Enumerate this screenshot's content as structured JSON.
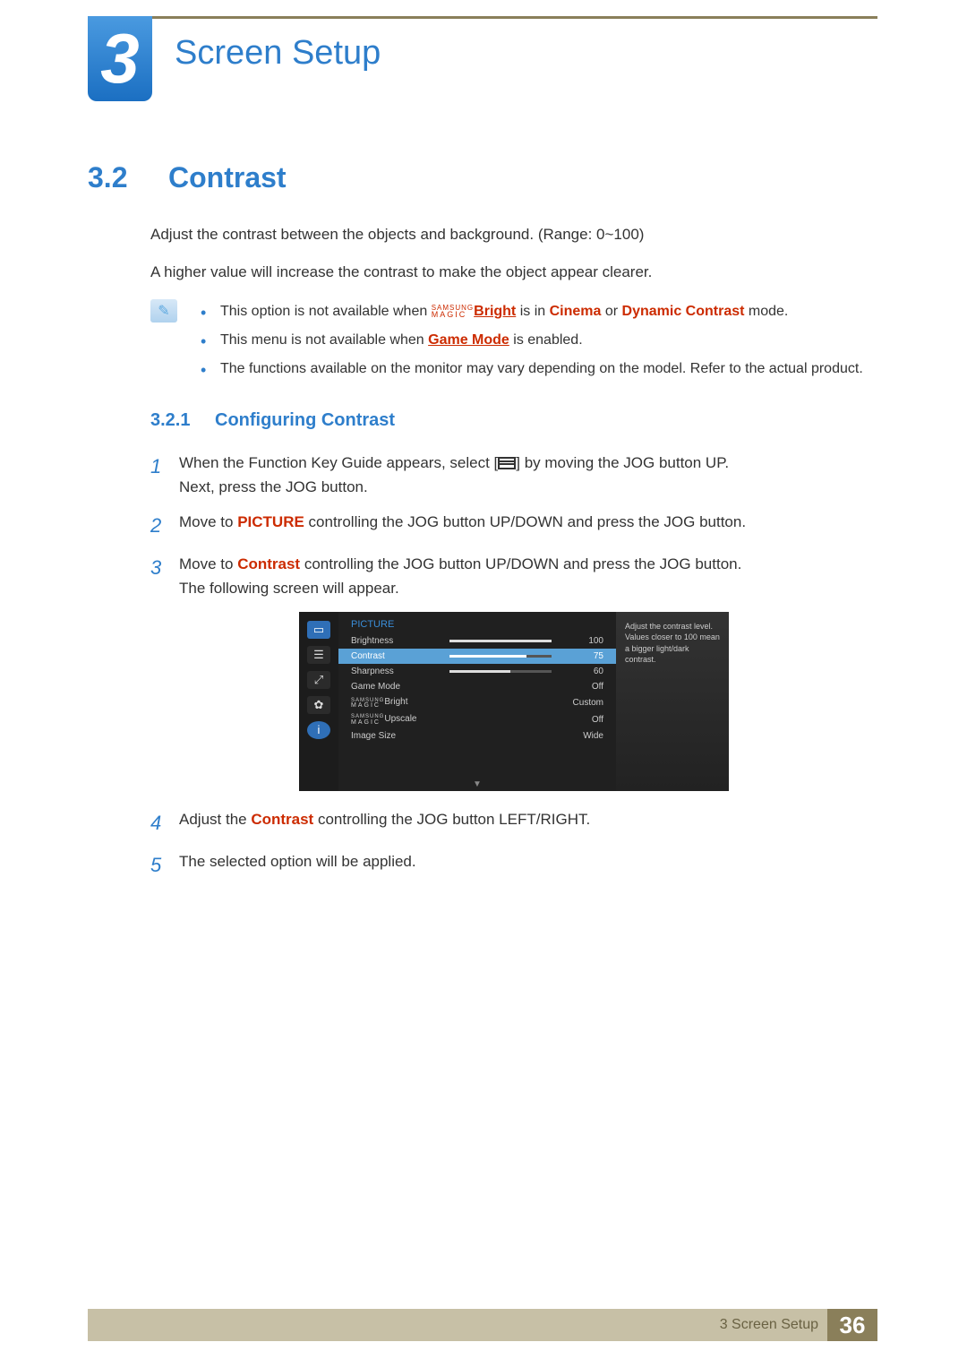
{
  "chapter": {
    "number": "3",
    "title": "Screen Setup"
  },
  "section": {
    "number": "3.2",
    "title": "Contrast"
  },
  "intro": {
    "p1": "Adjust the contrast between the objects and background. (Range: 0~100)",
    "p2": "A higher value will increase the contrast to make the object appear clearer."
  },
  "notes": {
    "n1a": "This option is not available when ",
    "magic_label_top": "SAMSUNG",
    "magic_label_bot": "MAGIC",
    "magic_bright": "Bright",
    "n1b": " is in ",
    "cinema": "Cinema",
    "or": " or ",
    "dynamic": "Dynamic Contrast",
    "n1c": " mode.",
    "n2a": "This menu is not available when ",
    "gamemode": "Game Mode",
    "n2b": " is enabled.",
    "n3": "The functions available on the monitor may vary depending on the model. Refer to the actual product."
  },
  "subsection": {
    "number": "3.2.1",
    "title": "Configuring Contrast"
  },
  "steps": {
    "s1a": "When the Function Key Guide appears, select [",
    "s1b": "] by moving the JOG button UP.",
    "s1c": "Next, press the JOG button.",
    "s2a": "Move to ",
    "s2p": "PICTURE",
    "s2b": " controlling the JOG button UP/DOWN and press the JOG button.",
    "s3a": "Move to ",
    "s3p": "Contrast",
    "s3b": " controlling the JOG button UP/DOWN and press the JOG button.",
    "s3c": "The following screen will appear.",
    "s4a": "Adjust the ",
    "s4p": "Contrast",
    "s4b": " controlling the JOG button LEFT/RIGHT.",
    "s5": "The selected option will be applied."
  },
  "osd": {
    "header": "PICTURE",
    "rows": {
      "brightness": {
        "label": "Brightness",
        "value": "100",
        "pct": 100
      },
      "contrast": {
        "label": "Contrast",
        "value": "75",
        "pct": 75
      },
      "sharpness": {
        "label": "Sharpness",
        "value": "60",
        "pct": 60
      },
      "gamemode": {
        "label": "Game Mode",
        "value": "Off"
      },
      "magicbright": {
        "magic_top": "SAMSUNG",
        "magic_bot": "MAGIC",
        "suffix": "Bright",
        "value": "Custom"
      },
      "magicupscale": {
        "magic_top": "SAMSUNG",
        "magic_bot": "MAGIC",
        "suffix": "Upscale",
        "value": "Off"
      },
      "imagesize": {
        "label": "Image Size",
        "value": "Wide"
      }
    },
    "help": "Adjust the contrast level. Values closer to 100 mean a bigger light/dark contrast."
  },
  "footer": {
    "text": "3 Screen Setup",
    "page": "36"
  }
}
